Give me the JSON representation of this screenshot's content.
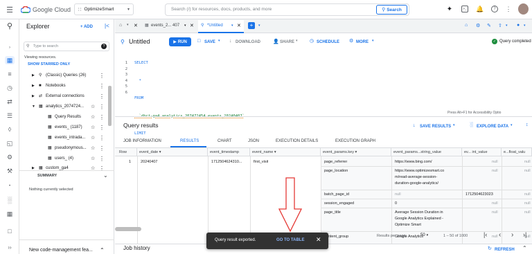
{
  "topbar": {
    "brand": "Google Cloud",
    "project": "OptimizeSmart",
    "search_placeholder": "Search (/) for resources, docs, products, and more",
    "search_button": "Search"
  },
  "explorer": {
    "title": "Explorer",
    "add_label": "+ ADD",
    "search_placeholder": "Type to search",
    "viewing": "Viewing resources.",
    "show_starred": "SHOW STARRED ONLY",
    "items": [
      {
        "label": "(Classic) Queries (26)"
      },
      {
        "label": "Notebooks"
      },
      {
        "label": "External connections"
      },
      {
        "label": "analytics_2074724..."
      },
      {
        "label": "Query Results"
      },
      {
        "label": "events_ (1187)"
      },
      {
        "label": "events_intrada..."
      },
      {
        "label": "pseudonymous..."
      },
      {
        "label": "users_ (4)"
      },
      {
        "label": "custom_ga4"
      }
    ],
    "summary": "SUMMARY",
    "nothing_selected": "Nothing currently selected",
    "footer": "New code-management fea..."
  },
  "editor_tabs": {
    "tab1": "events_2... 407",
    "tab2": "*Untitled"
  },
  "query": {
    "title": "Untitled",
    "run": "RUN",
    "save": "SAVE",
    "download": "DOWNLOAD",
    "share": "SHARE",
    "schedule": "SCHEDULE",
    "more": "MORE",
    "status": "Query completed",
    "line_numbers": [
      "1",
      "2",
      "3",
      "4",
      "5",
      "6"
    ],
    "lines": [
      "SELECT",
      "  *",
      "FROM",
      "  `dbrt-ga4.analytics_207472454.events_20240407`",
      "LIMIT",
      "  1000"
    ],
    "accessibility": "Press Alt+F1 for Accessibility Optio"
  },
  "results": {
    "title": "Query results",
    "save_results": "SAVE RESULTS",
    "explore_data": "EXPLORE DATA",
    "tabs": [
      "JOB INFORMATION",
      "RESULTS",
      "CHART",
      "JSON",
      "EXECUTION DETAILS",
      "EXECUTION GRAPH"
    ],
    "columns": [
      "Row",
      "event_date",
      "event_timestamp",
      "event_name",
      "event_params.key",
      "event_params...string_value",
      "ev... int_value",
      "e...float_valu"
    ],
    "row_num": "1",
    "event_date": "20240407",
    "event_timestamp": "1712504624310...",
    "event_name": "first_visit",
    "param_rows": [
      {
        "key": "page_referrer",
        "string_lines": [
          "https://www.bing.com/"
        ],
        "int": "null",
        "float": "null"
      },
      {
        "key": "page_location",
        "string_lines": [
          "https://www.optimizesmart.co",
          "m/read-average-session-",
          "duration-google-analytics/"
        ],
        "int": "null",
        "float": "null"
      },
      {
        "key": "batch_page_id",
        "string_lines": [
          "null"
        ],
        "int": "1712504623023",
        "float": "null"
      },
      {
        "key": "session_engaged",
        "string_lines": [
          "0"
        ],
        "int": "null",
        "float": "null"
      },
      {
        "key": "page_title",
        "string_lines": [
          "Average Session Duration in",
          "Google Analytics Explained -",
          "Optimize Smart"
        ],
        "int": "null",
        "float": "null"
      },
      {
        "key": "content_group",
        "string_lines": [
          "Google Analytics"
        ],
        "int": "null",
        "float": "null"
      }
    ],
    "per_page_label": "Results per page:",
    "per_page": "50",
    "range": "1 – 50 of 1000"
  },
  "toast": {
    "message": "Query result exported.",
    "action": "GO TO TABLE"
  },
  "job_history": {
    "title": "Job history",
    "refresh": "REFRESH"
  },
  "colors": {
    "accent": "#1a73e8",
    "annotation_arrow": "#e53935"
  }
}
